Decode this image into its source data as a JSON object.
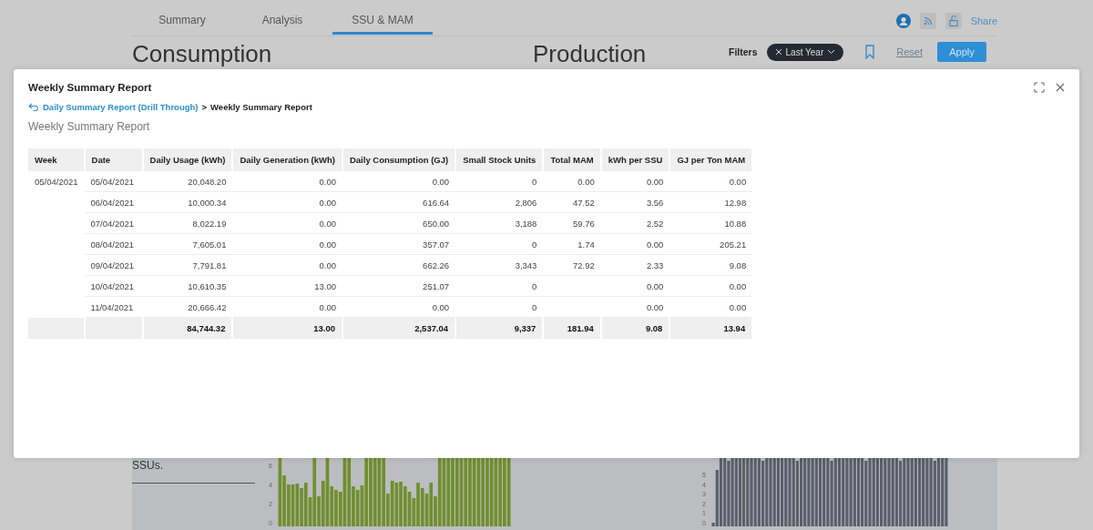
{
  "background": {
    "tabs": [
      {
        "label": "Summary",
        "selected": false
      },
      {
        "label": "Analysis",
        "selected": false
      },
      {
        "label": "SSU & MAM",
        "selected": true
      }
    ],
    "share": "Share",
    "headings": [
      "Consumption",
      "Production"
    ],
    "filters": {
      "label": "Filters",
      "chip": "Last Year",
      "reset": "Reset",
      "apply": "Apply"
    },
    "panel_text": "SSUs.",
    "left_chart_ticks": [
      "6",
      "4",
      "2",
      "0"
    ],
    "right_chart_ticks": [
      "5",
      "4",
      "3",
      "2",
      "1",
      "0"
    ]
  },
  "modal": {
    "title": "Weekly Summary Report",
    "breadcrumb": {
      "link": "Daily Summary Report (Drill Through)",
      "separator": ">",
      "current": "Weekly Summary Report"
    },
    "subtitle": "Weekly Summary Report",
    "table": {
      "columns": [
        "Week",
        "Date",
        "Daily Usage (kWh)",
        "Daily Generation (kWh)",
        "Daily Consumption (GJ)",
        "Small Stock Units",
        "Total MAM",
        "kWh per SSU",
        "GJ per Ton MAM"
      ],
      "rows": [
        [
          "05/04/2021",
          "05/04/2021",
          "20,048.20",
          "0.00",
          "0.00",
          "0",
          "0.00",
          "0.00",
          "0.00"
        ],
        [
          "",
          "06/04/2021",
          "10,000.34",
          "0.00",
          "616.64",
          "2,806",
          "47.52",
          "3.56",
          "12.98"
        ],
        [
          "",
          "07/04/2021",
          "8,022.19",
          "0.00",
          "650.00",
          "3,188",
          "59.76",
          "2.52",
          "10.88"
        ],
        [
          "",
          "08/04/2021",
          "7,605.01",
          "0.00",
          "357.07",
          "0",
          "1.74",
          "0.00",
          "205.21"
        ],
        [
          "",
          "09/04/2021",
          "7,791.81",
          "0.00",
          "662.26",
          "3,343",
          "72.92",
          "2.33",
          "9.08"
        ],
        [
          "",
          "10/04/2021",
          "10,610.35",
          "13.00",
          "251.07",
          "0",
          "",
          "0.00",
          "0.00"
        ],
        [
          "",
          "11/04/2021",
          "20,666.42",
          "0.00",
          "0.00",
          "0",
          "",
          "0.00",
          "0.00"
        ]
      ],
      "totals": [
        "84,744.32",
        "13.00",
        "2,537.04",
        "9,337",
        "181.94",
        "9.08",
        "13.94"
      ]
    }
  }
}
